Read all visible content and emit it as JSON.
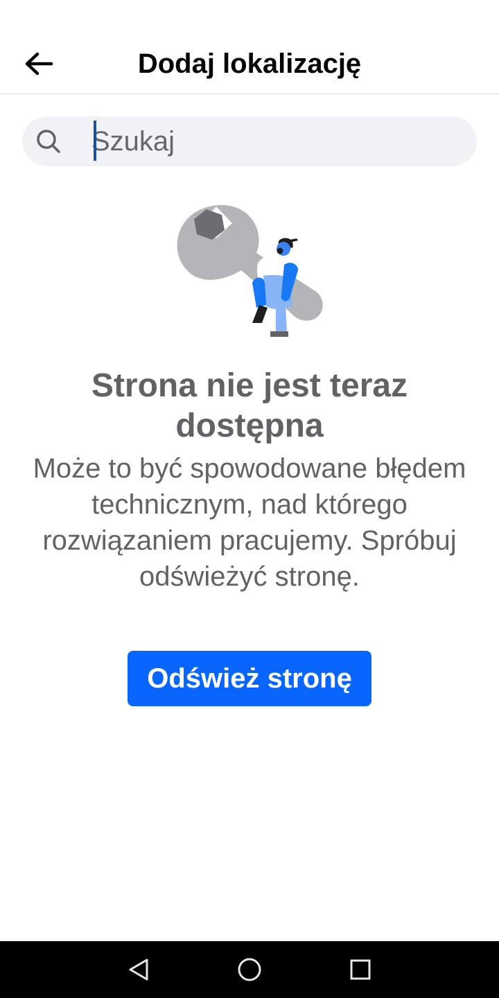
{
  "header": {
    "title": "Dodaj lokalizację",
    "back_icon": "arrow-left-icon"
  },
  "search": {
    "placeholder": "Szukaj",
    "value": "",
    "icon": "search-icon"
  },
  "error": {
    "illustration": "wrench-worker-illustration",
    "title": "Strona nie jest teraz dostępna",
    "description": "Może to być spowodowane błędem technicznym, nad którego rozwiązaniem pracujemy. Spróbuj odświeżyć stronę.",
    "button_label": "Odśwież stronę"
  },
  "system_nav": {
    "back_icon": "triangle-back-icon",
    "home_icon": "circle-home-icon",
    "recents_icon": "square-recents-icon"
  },
  "colors": {
    "accent": "#0866ff",
    "text_primary": "#050505",
    "text_secondary": "#606266",
    "search_bg": "#f0f2f5",
    "caret": "#1b4fa3"
  }
}
